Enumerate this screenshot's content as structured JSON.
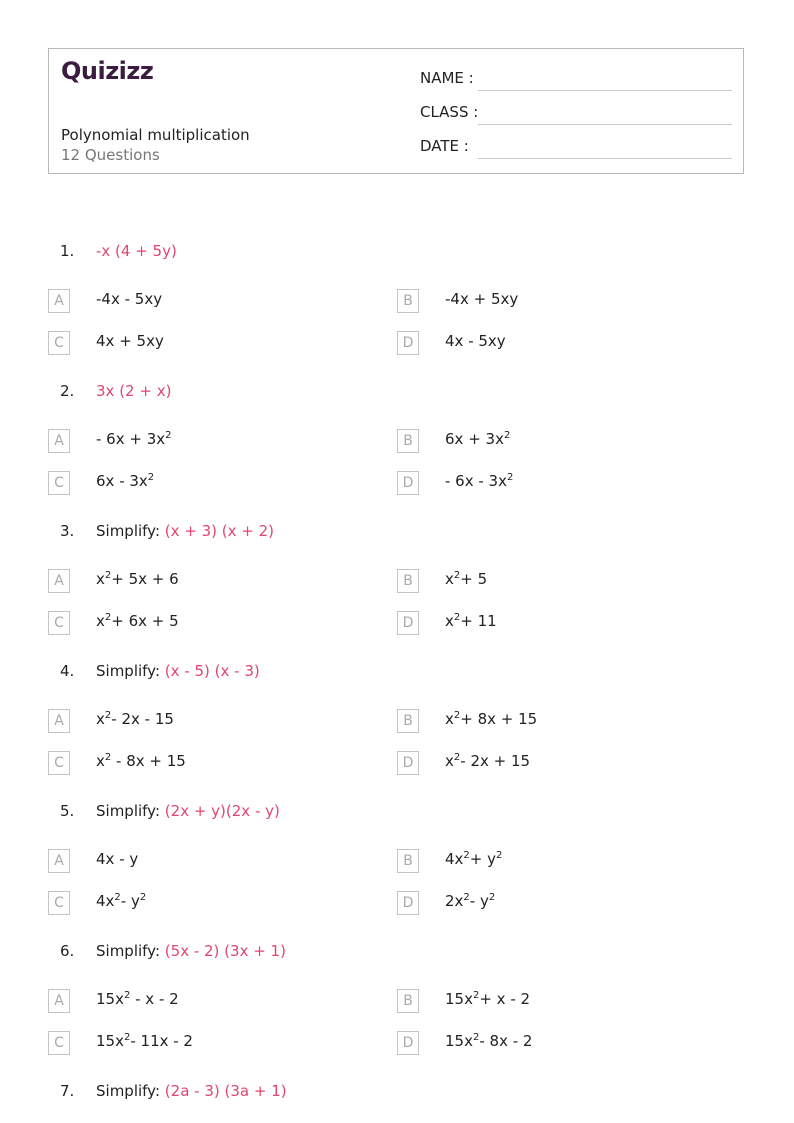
{
  "header": {
    "logo": "Quizizz",
    "title": "Polynomial multiplication",
    "subtitle": "12 Questions",
    "fields": [
      {
        "label": "NAME :",
        "value": ""
      },
      {
        "label": "CLASS :",
        "value": ""
      },
      {
        "label": "DATE  :",
        "value": ""
      }
    ]
  },
  "questions": [
    {
      "number": "1.",
      "prefix": "",
      "expression": "-x (4 + 5y)",
      "options": [
        {
          "letter": "A",
          "text": "-4x - 5xy"
        },
        {
          "letter": "B",
          "text": "-4x + 5xy"
        },
        {
          "letter": "C",
          "text": "4x + 5xy"
        },
        {
          "letter": "D",
          "text": "4x - 5xy"
        }
      ]
    },
    {
      "number": "2.",
      "prefix": "",
      "expression": "3x (2 + x)",
      "options": [
        {
          "letter": "A",
          "text": "- 6x + 3x^2"
        },
        {
          "letter": "B",
          "text": "6x + 3x^2"
        },
        {
          "letter": "C",
          "text": "6x - 3x^2"
        },
        {
          "letter": "D",
          "text": "- 6x - 3x^2"
        }
      ]
    },
    {
      "number": "3.",
      "prefix": "Simplify: ",
      "expression": "(x + 3) (x + 2)",
      "options": [
        {
          "letter": "A",
          "text": "x^2+ 5x + 6"
        },
        {
          "letter": "B",
          "text": "x^2+ 5"
        },
        {
          "letter": "C",
          "text": "x^2+ 6x + 5"
        },
        {
          "letter": "D",
          "text": "x^2+ 11"
        }
      ]
    },
    {
      "number": "4.",
      "prefix": "Simplify: ",
      "expression": "(x - 5) (x - 3)",
      "options": [
        {
          "letter": "A",
          "text": "x^2- 2x - 15"
        },
        {
          "letter": "B",
          "text": "x^2+ 8x + 15"
        },
        {
          "letter": "C",
          "text": "x^2 - 8x + 15"
        },
        {
          "letter": "D",
          "text": "x^2- 2x + 15"
        }
      ]
    },
    {
      "number": "5.",
      "prefix": "Simplify: ",
      "expression": "(2x + y)(2x - y)",
      "options": [
        {
          "letter": "A",
          "text": "4x - y"
        },
        {
          "letter": "B",
          "text": "4x^2+ y^2"
        },
        {
          "letter": "C",
          "text": "4x^2- y^2"
        },
        {
          "letter": "D",
          "text": "2x^2- y^2"
        }
      ]
    },
    {
      "number": "6.",
      "prefix": "Simplify: ",
      "expression": "(5x - 2) (3x + 1)",
      "options": [
        {
          "letter": "A",
          "text": "15x^2 - x - 2"
        },
        {
          "letter": "B",
          "text": "15x^2+ x - 2"
        },
        {
          "letter": "C",
          "text": "15x^2- 11x - 2"
        },
        {
          "letter": "D",
          "text": "15x^2- 8x - 2"
        }
      ]
    },
    {
      "number": "7.",
      "prefix": "Simplify: ",
      "expression": "(2a - 3) (3a + 1)",
      "options": []
    }
  ],
  "colors": {
    "accent": "#e0466e",
    "logo": "#3a1d3f",
    "border": "#b8b8b8"
  }
}
